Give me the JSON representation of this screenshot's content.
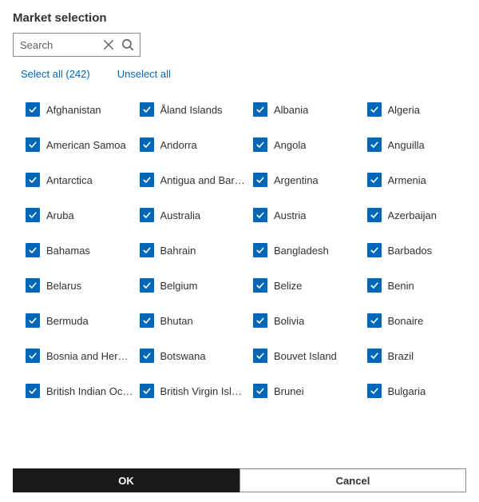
{
  "title": "Market selection",
  "search": {
    "placeholder": "Search",
    "value": ""
  },
  "links": {
    "select_all": "Select all (242)",
    "unselect_all": "Unselect all"
  },
  "markets": [
    {
      "label": "Afghanistan",
      "checked": true
    },
    {
      "label": "Åland Islands",
      "checked": true
    },
    {
      "label": "Albania",
      "checked": true
    },
    {
      "label": "Algeria",
      "checked": true
    },
    {
      "label": "American Samoa",
      "checked": true
    },
    {
      "label": "Andorra",
      "checked": true
    },
    {
      "label": "Angola",
      "checked": true
    },
    {
      "label": "Anguilla",
      "checked": true
    },
    {
      "label": "Antarctica",
      "checked": true
    },
    {
      "label": "Antigua and Barbuda",
      "checked": true
    },
    {
      "label": "Argentina",
      "checked": true
    },
    {
      "label": "Armenia",
      "checked": true
    },
    {
      "label": "Aruba",
      "checked": true
    },
    {
      "label": "Australia",
      "checked": true
    },
    {
      "label": "Austria",
      "checked": true
    },
    {
      "label": "Azerbaijan",
      "checked": true
    },
    {
      "label": "Bahamas",
      "checked": true
    },
    {
      "label": "Bahrain",
      "checked": true
    },
    {
      "label": "Bangladesh",
      "checked": true
    },
    {
      "label": "Barbados",
      "checked": true
    },
    {
      "label": "Belarus",
      "checked": true
    },
    {
      "label": "Belgium",
      "checked": true
    },
    {
      "label": "Belize",
      "checked": true
    },
    {
      "label": "Benin",
      "checked": true
    },
    {
      "label": "Bermuda",
      "checked": true
    },
    {
      "label": "Bhutan",
      "checked": true
    },
    {
      "label": "Bolivia",
      "checked": true
    },
    {
      "label": "Bonaire",
      "checked": true
    },
    {
      "label": "Bosnia and Herzegovina",
      "checked": true
    },
    {
      "label": "Botswana",
      "checked": true
    },
    {
      "label": "Bouvet Island",
      "checked": true
    },
    {
      "label": "Brazil",
      "checked": true
    },
    {
      "label": "British Indian Ocean Territory",
      "checked": true
    },
    {
      "label": "British Virgin Islands",
      "checked": true
    },
    {
      "label": "Brunei",
      "checked": true
    },
    {
      "label": "Bulgaria",
      "checked": true
    }
  ],
  "footer": {
    "ok": "OK",
    "cancel": "Cancel"
  },
  "colors": {
    "accent": "#0067b8",
    "link": "#0067b8",
    "primary_btn": "#1b1a19"
  }
}
